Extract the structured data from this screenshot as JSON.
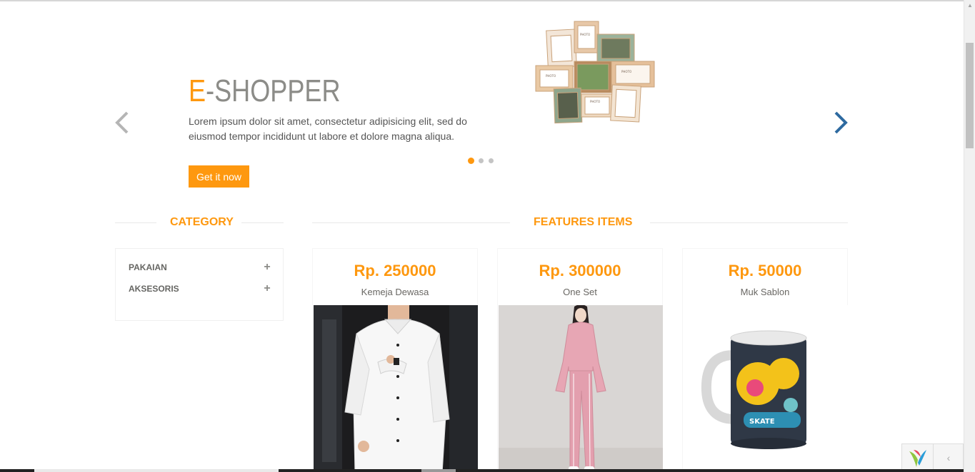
{
  "slider": {
    "brand_accent": "E",
    "brand_rest": "-SHOPPER",
    "description": "Lorem ipsum dolor sit amet, consectetur adipisicing elit, sed do eiusmod tempor incididunt ut labore et dolore magna aliqua.",
    "cta_label": "Get it now",
    "active_slide": 1,
    "slide_count": 3
  },
  "sections": {
    "category_title": "CATEGORY",
    "features_title": "FEATURES ITEMS"
  },
  "categories": [
    {
      "label": "PAKAIAN",
      "icon": "plus-icon"
    },
    {
      "label": "AKSESORIS",
      "icon": "plus-icon"
    }
  ],
  "products": [
    {
      "price": "Rp. 250000",
      "name": "Kemeja Dewasa",
      "image": "white-shirt-photo"
    },
    {
      "price": "Rp. 300000",
      "name": "One Set",
      "image": "pink-tracksuit-photo"
    },
    {
      "price": "Rp. 50000",
      "name": "Muk Sablon",
      "image": "printed-mug-photo"
    }
  ],
  "colors": {
    "accent": "#fe980f",
    "arrow_left": "#b5b5b5",
    "arrow_right": "#2e6aa0"
  }
}
